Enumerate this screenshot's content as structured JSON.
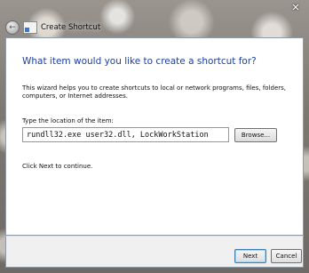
{
  "window": {
    "title": "Create Shortcut",
    "close_glyph": "✕"
  },
  "main": {
    "heading": "What item would you like to create a shortcut for?",
    "description": "This wizard helps you to create shortcuts to local or network programs, files, folders, computers, or Internet addresses.",
    "location_label": "Type the location of the item:",
    "location_value": "rundll32.exe user32.dll, LockWorkStation",
    "browse_label": "Browse...",
    "next_hint": "Click Next to continue."
  },
  "footer": {
    "next_label": "Next",
    "cancel_label": "Cancel"
  }
}
